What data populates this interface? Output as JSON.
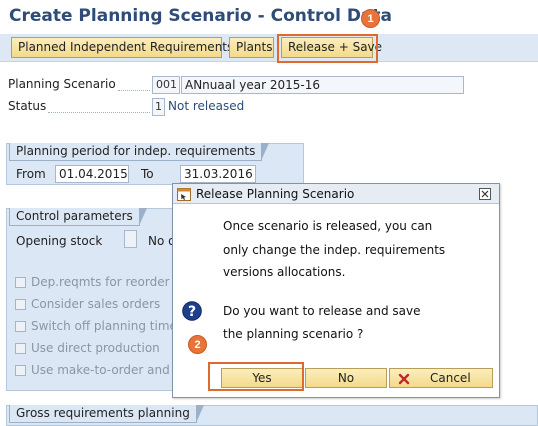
{
  "header": {
    "title": "Create Planning Scenario - Control Data"
  },
  "callouts": {
    "one": "1",
    "two": "2"
  },
  "toolbar": {
    "pir_label": "Planned Independent Requirements",
    "plants_label": "Plants",
    "release_save_label": "Release + Save"
  },
  "form": {
    "scenario_label": "Planning Scenario",
    "scenario_code": "001",
    "scenario_desc": "ANnuaal year 2015-16",
    "status_label": "Status",
    "status_code": "1",
    "status_text": "Not released"
  },
  "period": {
    "title": "Planning period for indep. requirements",
    "from_label": "From",
    "from_value": "01.04.2015",
    "to_label": "To",
    "to_value": "31.03.2016"
  },
  "control": {
    "title": "Control parameters",
    "opening_stock_label": "Opening stock",
    "opening_stock_value": "No o",
    "options": [
      "Dep.reqmts for reorder po",
      "Consider sales orders",
      "Switch off planning time fe",
      "Use direct production",
      "Use make-to-order and pro"
    ]
  },
  "gross": {
    "title": "Gross requirements planning"
  },
  "dialog": {
    "title": "Release Planning Scenario",
    "info_lines": [
      "Once scenario is released, you can",
      "only change the indep. requirements",
      "versions allocations."
    ],
    "question_lines": [
      "Do you want to release and save",
      "the planning scenario ?"
    ],
    "yes_label": "Yes",
    "no_label": "No",
    "cancel_label": "Cancel"
  },
  "colors": {
    "accent": "#e06a2c",
    "title": "#2e4c77",
    "panel": "#dbe7f4"
  }
}
